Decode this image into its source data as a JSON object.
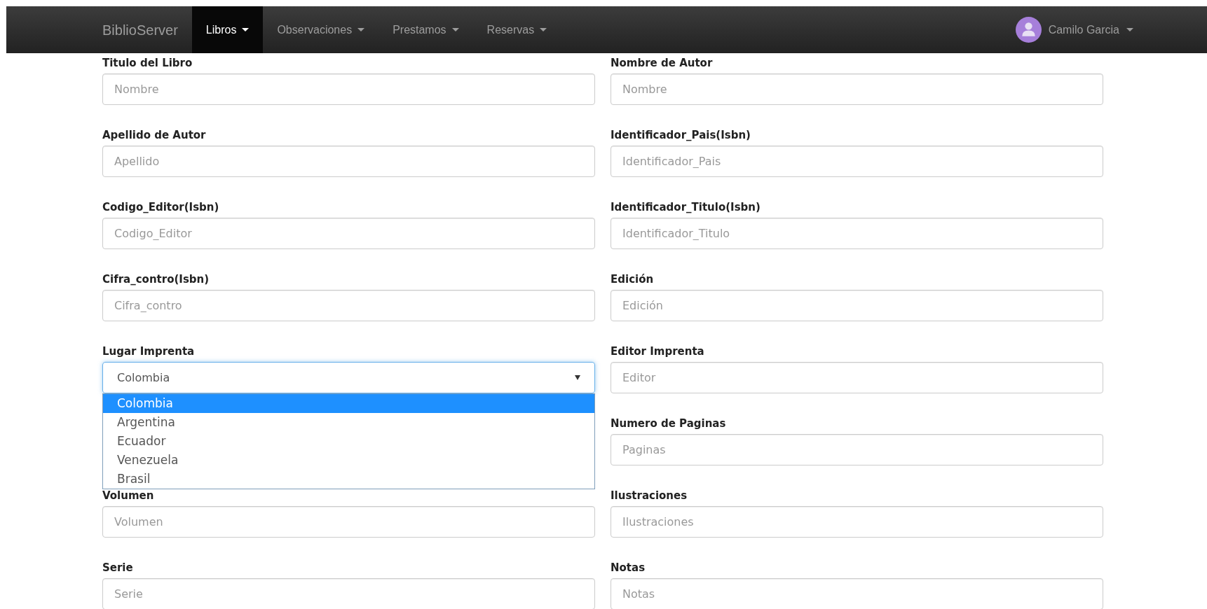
{
  "navbar": {
    "brand": "BiblioServer",
    "menus": [
      {
        "label": "Libros",
        "selected": true
      },
      {
        "label": "Observaciones",
        "selected": false
      },
      {
        "label": "Prestamos",
        "selected": false
      },
      {
        "label": "Reservas",
        "selected": false
      }
    ],
    "user": {
      "name": "Camilo Garcia"
    }
  },
  "form": {
    "rows": [
      {
        "left": {
          "label": "Titulo del Libro",
          "kind": "text",
          "placeholder": "Nombre"
        },
        "right": {
          "label": "Nombre de Autor",
          "kind": "text",
          "placeholder": "Nombre"
        }
      },
      {
        "left": {
          "label": "Apellido de Autor",
          "kind": "text",
          "placeholder": "Apellido"
        },
        "right": {
          "label": "Identificador_Pais(Isbn)",
          "kind": "text",
          "placeholder": "Identificador_Pais"
        }
      },
      {
        "left": {
          "label": "Codigo_Editor(Isbn)",
          "kind": "text",
          "placeholder": "Codigo_Editor"
        },
        "right": {
          "label": "Identificador_Titulo(Isbn)",
          "kind": "text",
          "placeholder": "Identificador_Titulo"
        }
      },
      {
        "left": {
          "label": "Cifra_contro(Isbn)",
          "kind": "text",
          "placeholder": "Cifra_contro"
        },
        "right": {
          "label": "Edición",
          "kind": "text",
          "placeholder": "Edición"
        }
      },
      {
        "left": {
          "label": "Lugar Imprenta",
          "kind": "select",
          "value": "Colombia",
          "expanded": true,
          "options": [
            {
              "label": "Colombia",
              "selected": true
            },
            {
              "label": "Argentina",
              "selected": false
            },
            {
              "label": "Ecuador",
              "selected": false
            },
            {
              "label": "Venezuela",
              "selected": false
            },
            {
              "label": "Brasil",
              "selected": false
            }
          ]
        },
        "right": {
          "label": "Editor Imprenta",
          "kind": "text",
          "placeholder": "Editor"
        }
      },
      {
        "right": {
          "label": "Numero de Paginas",
          "kind": "text",
          "placeholder": "Paginas"
        }
      },
      {
        "left": {
          "label": "Volumen",
          "kind": "text",
          "placeholder": "Volumen"
        },
        "right": {
          "label": "Ilustraciones",
          "kind": "text",
          "placeholder": "Ilustraciones"
        }
      },
      {
        "left": {
          "label": "Serie",
          "kind": "text",
          "placeholder": "Serie"
        },
        "right": {
          "label": "Notas",
          "kind": "text",
          "placeholder": "Notas"
        }
      }
    ]
  }
}
